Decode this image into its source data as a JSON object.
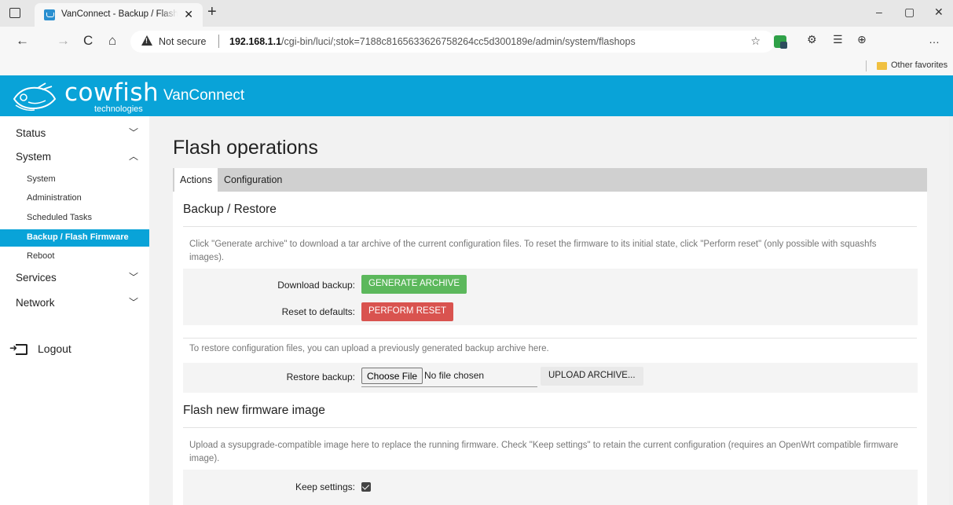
{
  "browser": {
    "tab_title": "VanConnect - Backup / Flash Firmware",
    "not_secure": "Not secure",
    "url_host": "192.168.1.1",
    "url_path": "/cgi-bin/luci/;stok=7188c8165633626758264cc5d300189e/admin/system/flashops",
    "favorites_label": "Other favorites",
    "icons": {
      "back": "←",
      "forward": "→",
      "refresh": "C",
      "home": "⌂",
      "star": "☆",
      "extensions": "⚙",
      "favorites": "☰",
      "collections": "⊕",
      "more": "…",
      "minimize": "–",
      "restore": "▢",
      "close": "✕",
      "new_tab": "+"
    }
  },
  "app": {
    "logo_main": "cowfish",
    "logo_sub": "technologies",
    "title": "VanConnect",
    "brand_color": "#09a3d8"
  },
  "sidebar": {
    "items": [
      {
        "label": "Status",
        "chevron": "﹀"
      },
      {
        "label": "System",
        "chevron": "︿"
      },
      {
        "label": "Services",
        "chevron": "﹀"
      },
      {
        "label": "Network",
        "chevron": "﹀"
      }
    ],
    "system_subitems": [
      {
        "label": "System"
      },
      {
        "label": "Administration"
      },
      {
        "label": "Scheduled Tasks"
      },
      {
        "label": "Backup / Flash Firmware",
        "active": true
      },
      {
        "label": "Reboot"
      }
    ],
    "logout": "Logout"
  },
  "main": {
    "page_title": "Flash operations",
    "tabs": [
      {
        "label": "Actions",
        "active": true
      },
      {
        "label": "Configuration"
      }
    ],
    "backup": {
      "title": "Backup / Restore",
      "description": "Click \"Generate archive\" to download a tar archive of the current configuration files. To reset the firmware to its initial state, click \"Perform reset\" (only possible with squashfs images).",
      "download_label": "Download backup:",
      "generate_button": "GENERATE ARCHIVE",
      "reset_label": "Reset to defaults:",
      "reset_button": "PERFORM RESET",
      "restore_description": "To restore configuration files, you can upload a previously generated backup archive here.",
      "restore_label": "Restore backup:",
      "choose_file": "Choose File",
      "no_file": "No file chosen",
      "upload_button": "UPLOAD ARCHIVE..."
    },
    "flash": {
      "title": "Flash new firmware image",
      "description": "Upload a sysupgrade-compatible image here to replace the running firmware. Check \"Keep settings\" to retain the current configuration (requires an OpenWrt compatible firmware image).",
      "keep_label": "Keep settings:",
      "keep_checked": true
    }
  }
}
